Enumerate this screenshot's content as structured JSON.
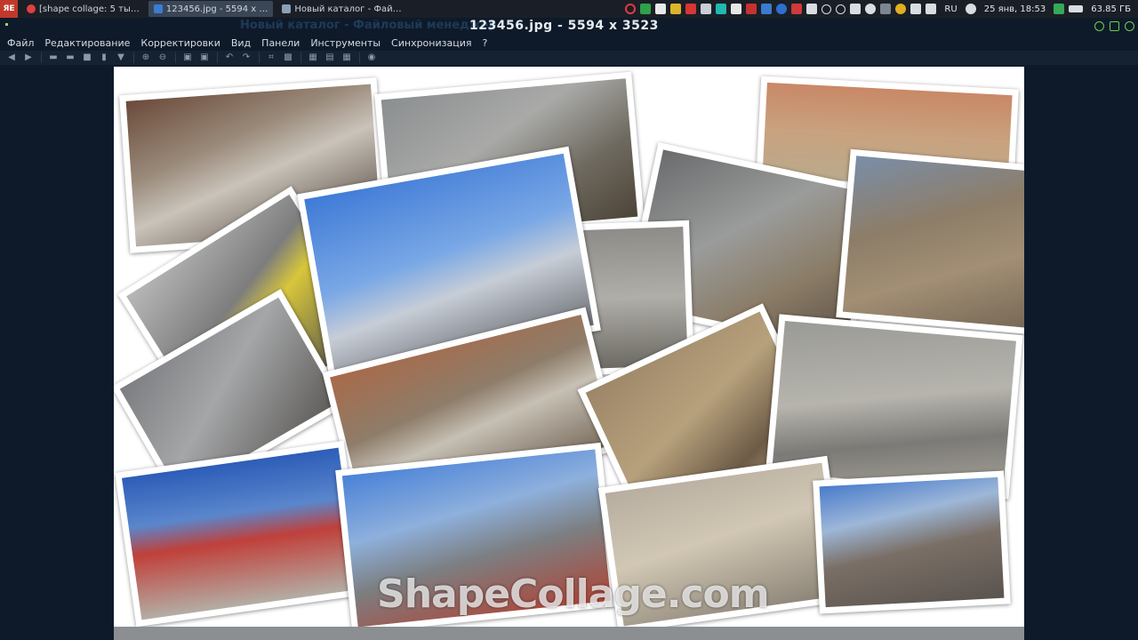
{
  "taskbar": {
    "app_badge": "ЯЕ",
    "tasks": [
      {
        "label": "[shape collage: 5 ты…",
        "icon_color": "#e04040"
      },
      {
        "label": "123456.jpg - 5594 x …",
        "icon_color": "#3b7bd6"
      },
      {
        "label": "Новый каталог - Фай…",
        "icon_color": "#8aa0b8"
      }
    ],
    "language": "RU",
    "datetime": "25 янв, 18:53",
    "storage": "63.85 ГБ"
  },
  "window": {
    "title": "123456.jpg  - 5594 x 3523",
    "ghost_title": "Новый каталог - Файловый менеджер"
  },
  "menu": {
    "items": [
      "Файл",
      "Редактирование",
      "Корректировки",
      "Вид",
      "Панели",
      "Инструменты",
      "Синхронизация",
      "?"
    ]
  },
  "toolbar": {
    "buttons": [
      "arrow-left-icon",
      "arrow-right-icon",
      "folder-icon",
      "folder-open-icon",
      "save-icon",
      "trash-icon",
      "filter-icon",
      "zoom-in-icon",
      "zoom-out-icon",
      "copy-icon",
      "paste-icon",
      "undo-icon",
      "redo-icon",
      "crop-icon",
      "resize-icon",
      "grid-icon",
      "fit-icon",
      "fullscreen-icon",
      "settings-icon"
    ]
  },
  "image": {
    "watermark": "ShapeCollage.com"
  }
}
